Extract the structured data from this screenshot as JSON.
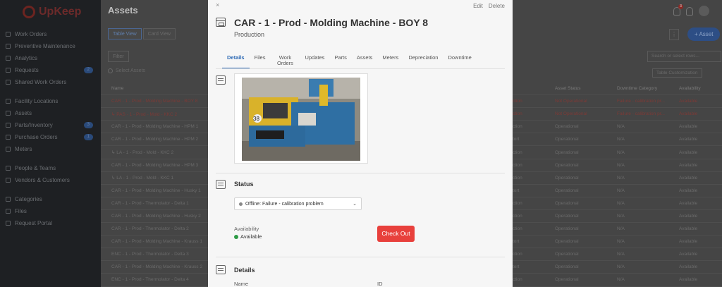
{
  "app": {
    "logo_text": "UpKeep"
  },
  "sidebar": {
    "items": [
      {
        "label": "Work Orders"
      },
      {
        "label": "Preventive Maintenance"
      },
      {
        "label": "Analytics"
      },
      {
        "label": "Requests",
        "badge": "2"
      },
      {
        "label": "Shared Work Orders"
      },
      {
        "label": "Facility Locations"
      },
      {
        "label": "Assets"
      },
      {
        "label": "Parts/Inventory",
        "badge": "3"
      },
      {
        "label": "Purchase Orders",
        "badge": "1"
      },
      {
        "label": "Meters"
      },
      {
        "label": "People & Teams"
      },
      {
        "label": "Vendors & Customers"
      },
      {
        "label": "Categories"
      },
      {
        "label": "Files"
      },
      {
        "label": "Request Portal"
      }
    ]
  },
  "main": {
    "title": "Assets",
    "view_buttons": [
      "Table View",
      "Card View"
    ],
    "filter_label": "Filter",
    "select_all": "Select Assets",
    "more_label": "⋮",
    "add_asset": "+ Asset",
    "search_placeholder": "Search or select rows...",
    "table_customization": "Table Customization",
    "notification_count": "3",
    "table_left": {
      "header": "Name",
      "rows": [
        {
          "name": "CAR - 1 - Prod - Molding Machine - BOY 8",
          "red": true
        },
        {
          "name": "↳ PAS - 1 - Prod - Mold - KKC 2",
          "red": true
        },
        {
          "name": "CAR - 1 - Prod - Molding Machine - HPM 1",
          "red": false
        },
        {
          "name": "CAR - 1 - Prod - Molding Machine - HPM 2",
          "red": false
        },
        {
          "name": "↳ LA - 1 - Prod - Mold - KKC 2",
          "red": false
        },
        {
          "name": "CAR - 1 - Prod - Molding Machine - HPM 3",
          "red": false
        },
        {
          "name": "↳ LA - 1 - Prod - Mold - KKC 1",
          "red": false
        },
        {
          "name": "CAR - 1 - Prod - Molding Machine - Husky 1",
          "red": false
        },
        {
          "name": "CAR - 1 - Prod - Thermolator - Delta 1",
          "red": false
        },
        {
          "name": "CAR - 1 - Prod - Molding Machine - Husky 2",
          "red": false
        },
        {
          "name": "CAR - 1 - Prod - Thermolator - Delta 2",
          "red": false
        },
        {
          "name": "CAR - 1 - Prod - Molding Machine - Krauss 1",
          "red": false
        },
        {
          "name": "ENC - 1 - Prod - Thermolator - Delta 3",
          "red": false
        },
        {
          "name": "CAR - 1 - Prod - Molding Machine - Krauss 2",
          "red": false
        },
        {
          "name": "ENC - 1 - Prod - Thermolator - Delta 4",
          "red": false
        }
      ]
    },
    "table_right": {
      "headers": [
        "",
        "Asset Status",
        "Downtime Category",
        "Availability"
      ],
      "rows": [
        [
          "ction",
          "Not Operational",
          "Failure - calibration pr...",
          "Available",
          true
        ],
        [
          "ction",
          "Not Operational",
          "Failure - calibration pr...",
          "Available",
          true
        ],
        [
          "ction",
          "Operational",
          "N/A",
          "Available",
          false
        ],
        [
          "tort",
          "Operational",
          "N/A",
          "Available",
          false
        ],
        [
          "ction",
          "Operational",
          "N/A",
          "Available",
          false
        ],
        [
          "ction",
          "Operational",
          "N/A",
          "Available",
          false
        ],
        [
          "ction",
          "Operational",
          "N/A",
          "Available",
          false
        ],
        [
          "tort",
          "Operational",
          "N/A",
          "Available",
          false
        ],
        [
          "ction",
          "Operational",
          "N/A",
          "Available",
          false
        ],
        [
          "ction",
          "Operational",
          "N/A",
          "Available",
          false
        ],
        [
          "ction",
          "Operational",
          "N/A",
          "Available",
          false
        ],
        [
          "tort",
          "Operational",
          "N/A",
          "Available",
          false
        ],
        [
          "ction",
          "Operational",
          "N/A",
          "Available",
          false
        ],
        [
          "tort",
          "Operational",
          "N/A",
          "Available",
          false
        ],
        [
          "ction",
          "Operational",
          "N/A",
          "Available",
          false
        ]
      ]
    }
  },
  "panel": {
    "close": "×",
    "edit": "Edit",
    "delete": "Delete",
    "title": "CAR - 1 - Prod - Molding Machine - BOY 8",
    "subtitle": "Production",
    "tabs": [
      "Details",
      "Files",
      "Work Orders",
      "Updates",
      "Parts",
      "Assets",
      "Meters",
      "Depreciation",
      "Downtime"
    ],
    "photo_number": "38",
    "status_title": "Status",
    "status_value": "Offline: Failure - calibration problem",
    "availability_label": "Availability",
    "availability_value": "Available",
    "checkout_label": "Check Out",
    "details_title": "Details",
    "field_name": "Name",
    "field_id": "ID"
  }
}
